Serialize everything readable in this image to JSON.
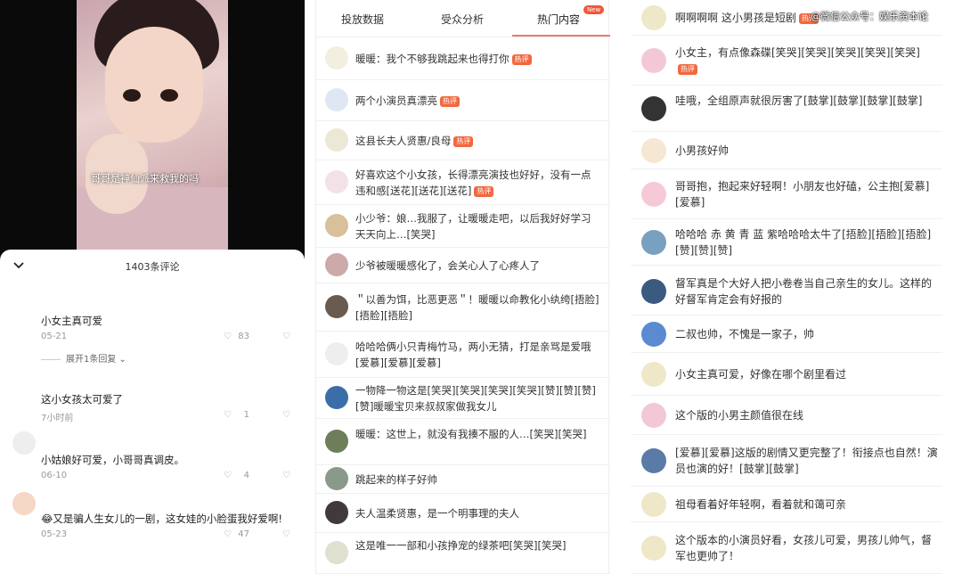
{
  "video": {
    "caption": "哥哥是神仙派来救我的吗"
  },
  "comments_sheet": {
    "count_label": "1403条评论",
    "comments": [
      {
        "text": "小女主真可爱",
        "time": "05-21",
        "likes": "83"
      },
      {
        "text": "这小女孩太可爱了",
        "time": "7小时前",
        "likes": "1"
      },
      {
        "text": "小姑娘好可爱，小哥哥真调皮。",
        "time": "06-10",
        "likes": "4"
      },
      {
        "text": "😂又是骗人生女儿的一剧，这女娃的小脸蛋我好爱啊!",
        "time": "05-23",
        "likes": "47"
      }
    ],
    "reply_expand": "展开1条回复"
  },
  "middle": {
    "tabs": [
      "投放数据",
      "受众分析",
      "热门内容"
    ],
    "new_badge": "New",
    "hot_label": "热评",
    "rows": [
      {
        "text": "暖暖：我个不够我跳起来也得打你",
        "hot": true
      },
      {
        "text": "两个小演员真漂亮",
        "hot": true
      },
      {
        "text": "这县长夫人贤惠/良母",
        "hot": true
      },
      {
        "text": "好喜欢这个小女孩，长得漂亮演技也好好，没有一点违和感[送花][送花][送花]",
        "hot": true
      },
      {
        "text": "小少爷：娘…我服了，让暖暖走吧，以后我好好学习天天向上…[笑哭]",
        "hot": false
      },
      {
        "text": "少爷被暖暖感化了，会关心人了心疼人了",
        "hot": false
      },
      {
        "text": "＂以善为饵，比恶更恶＂！暖暖以命教化小纨绔[捂脸][捂脸][捂脸]",
        "hot": false
      },
      {
        "text": "哈哈哈俩小只青梅竹马，两小无猜，打是亲骂是爱哦[爱慕][爱慕][爱慕]",
        "hot": false
      },
      {
        "text": "一物降一物这是[笑哭][笑哭][笑哭][笑哭][赞][赞][赞][赞]暖暖宝贝来叔叔家做我女儿",
        "hot": false
      },
      {
        "text": "暖暖：这世上，就没有我揍不服的人…[笑哭][笑哭]",
        "hot": false
      },
      {
        "text": "跳起来的样子好帅",
        "hot": false
      },
      {
        "text": "夫人温柔贤惠，是一个明事理的夫人",
        "hot": false
      },
      {
        "text": "这是唯一一部和小孩挣宠的绿茶吧[笑哭][笑哭]",
        "hot": false
      }
    ]
  },
  "right": {
    "watermark": "@微信公众号：娱乐资本论",
    "rows": [
      {
        "text": "啊啊啊啊 这小男孩是短剧",
        "hot": true
      },
      {
        "text": "小女主，有点像森碟[笑哭][笑哭][笑哭][笑哭][笑哭]",
        "hot": true
      },
      {
        "text": "哇哦，全组原声就很厉害了[鼓掌][鼓掌][鼓掌][鼓掌]",
        "hot": false
      },
      {
        "text": "小男孩好帅",
        "hot": false
      },
      {
        "text": "哥哥抱，抱起来好轻啊！小朋友也好磕，公主抱[爱慕][爱慕]",
        "hot": false
      },
      {
        "text": "哈哈哈 赤 黄 青 蓝 紫哈哈哈太牛了[捂脸][捂脸][捂脸][赞][赞][赞]",
        "hot": false
      },
      {
        "text": "督军真是个大好人把小卷卷当自己亲生的女儿。这样的好督军肯定会有好报的",
        "hot": false
      },
      {
        "text": "二叔也帅，不愧是一家子，帅",
        "hot": false
      },
      {
        "text": "小女主真可爱，好像在哪个剧里看过",
        "hot": false
      },
      {
        "text": "这个版的小男主颜值很在线",
        "hot": false
      },
      {
        "text": "[爱慕][爱慕]这版的剧情又更完整了！衔接点也自然！演员也演的好！[鼓掌][鼓掌]",
        "hot": false
      },
      {
        "text": "祖母看着好年轻啊，看着就和蔼可亲",
        "hot": false
      },
      {
        "text": "这个版本的小演员好看，女孩儿可爱，男孩儿帅气，督军也更帅了！",
        "hot": false
      }
    ]
  }
}
